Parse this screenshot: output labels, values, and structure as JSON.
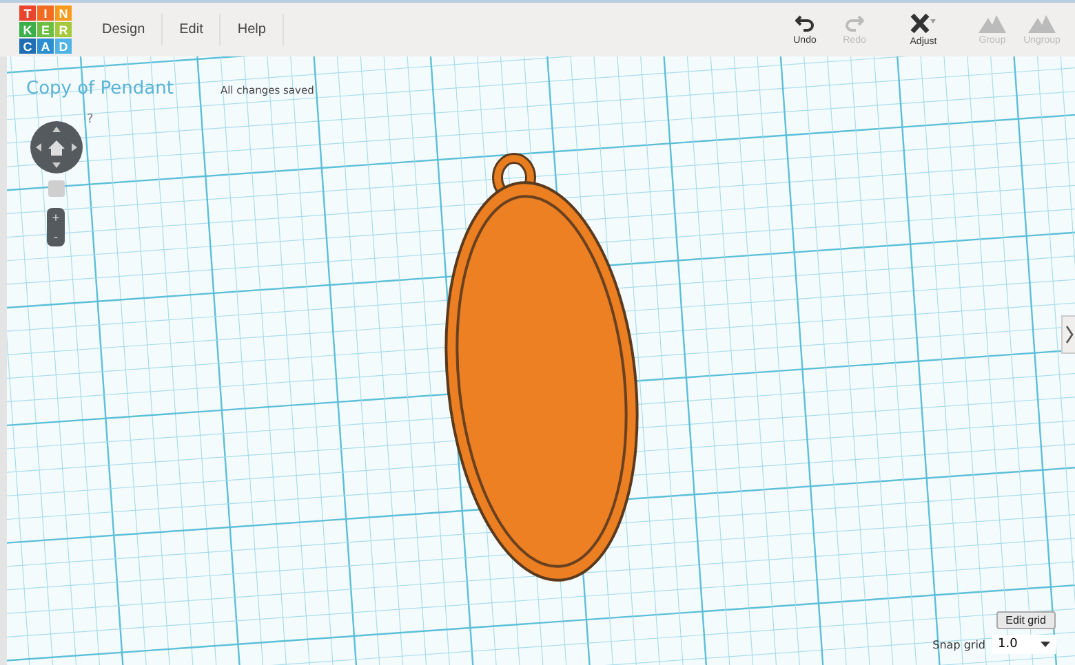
{
  "logo": {
    "letters": [
      {
        "text": "T",
        "color": "#e8452c"
      },
      {
        "text": "I",
        "color": "#f26b21"
      },
      {
        "text": "N",
        "color": "#f89b1c"
      },
      {
        "text": "K",
        "color": "#3bb04a"
      },
      {
        "text": "E",
        "color": "#6cbf42"
      },
      {
        "text": "R",
        "color": "#a4c93a"
      },
      {
        "text": "C",
        "color": "#1f6db3"
      },
      {
        "text": "A",
        "color": "#2b8fd1"
      },
      {
        "text": "D",
        "color": "#4fb3e6"
      }
    ]
  },
  "menu": [
    "Design",
    "Edit",
    "Help"
  ],
  "toolbar": [
    {
      "label": "Undo",
      "kind": "undo",
      "disabled": false
    },
    {
      "label": "Redo",
      "kind": "redo",
      "disabled": true
    },
    {
      "label": "Adjust",
      "kind": "adjust",
      "disabled": false
    },
    {
      "label": "Group",
      "kind": "group",
      "disabled": true
    },
    {
      "label": "Ungroup",
      "kind": "ungroup",
      "disabled": true
    }
  ],
  "project": {
    "title": "Copy of Pendant",
    "status": "All changes saved"
  },
  "view_controls": {
    "help": "?",
    "zoom_in": "+",
    "zoom_out": "-"
  },
  "grid": {
    "edit_button": "Edit grid",
    "snap_label": "Snap grid",
    "snap_value": "1.0"
  }
}
